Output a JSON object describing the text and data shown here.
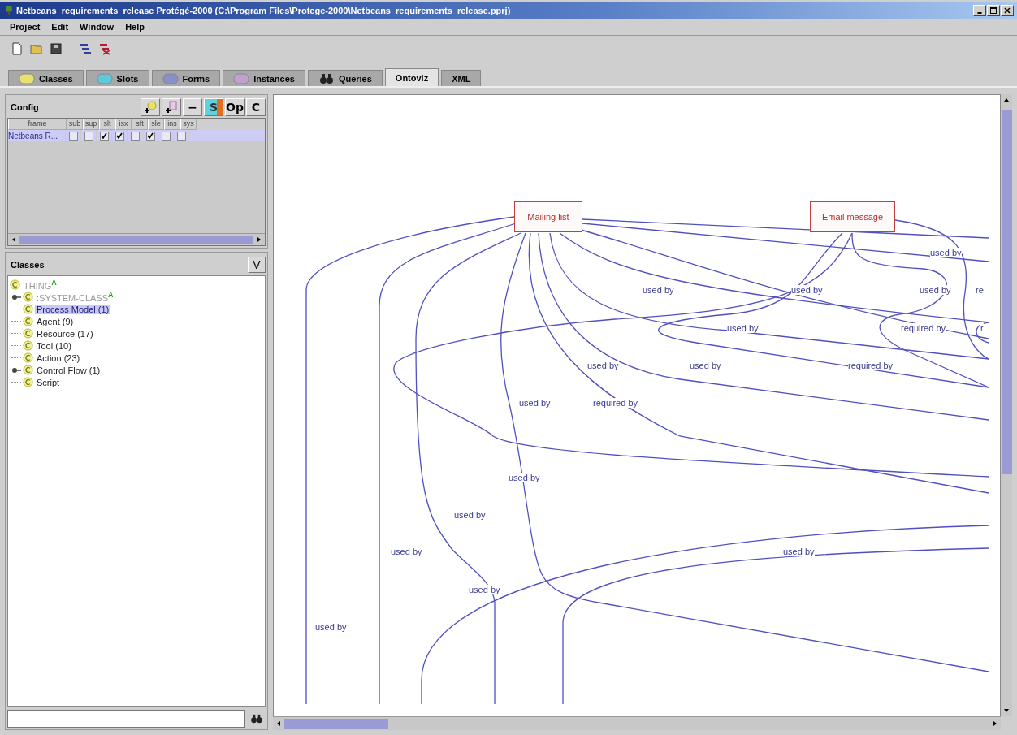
{
  "window": {
    "title": "Netbeans_requirements_release  Protégé-2000   (C:\\Program Files\\Protege-2000\\Netbeans_requirements_release.pprj)"
  },
  "menu": [
    "Project",
    "Edit",
    "Window",
    "Help"
  ],
  "tabs": [
    {
      "label": "Classes",
      "kind": "classes",
      "selected": false
    },
    {
      "label": "Slots",
      "kind": "slots",
      "selected": false
    },
    {
      "label": "Forms",
      "kind": "forms",
      "selected": false
    },
    {
      "label": "Instances",
      "kind": "instances",
      "selected": false
    },
    {
      "label": "Queries",
      "kind": "queries",
      "selected": false
    },
    {
      "label": "Ontoviz",
      "kind": "plain",
      "selected": true
    },
    {
      "label": "XML",
      "kind": "plain",
      "selected": false
    }
  ],
  "config": {
    "title": "Config",
    "buttons": [
      {
        "kind": "add-class"
      },
      {
        "kind": "add-instance"
      },
      {
        "kind": "text",
        "label": "−"
      },
      {
        "kind": "slot",
        "label": "S"
      },
      {
        "kind": "text",
        "label": "Op"
      },
      {
        "kind": "text",
        "label": "C"
      }
    ],
    "columns": [
      "frame",
      "sub",
      "sup",
      "slt",
      "isx",
      "sft",
      "sle",
      "ins",
      "sys"
    ],
    "rows": [
      {
        "frame": "Netbeans R...",
        "selected": true,
        "checks": [
          false,
          false,
          true,
          true,
          false,
          true,
          false,
          false
        ]
      }
    ]
  },
  "classes": {
    "title": "Classes",
    "button": "V",
    "tree": [
      {
        "label": "THING",
        "badge": "A",
        "system": true,
        "selected": false,
        "children": [
          {
            "label": ":SYSTEM-CLASS",
            "badge": "A",
            "system": true,
            "selected": false,
            "expanded": false
          },
          {
            "label": "Process Model  (1)",
            "system": false,
            "selected": true
          },
          {
            "label": "Agent  (9)",
            "system": false,
            "selected": false
          },
          {
            "label": "Resource  (17)",
            "system": false,
            "selected": false
          },
          {
            "label": "Tool  (10)",
            "system": false,
            "selected": false
          },
          {
            "label": "Action  (23)",
            "system": false,
            "selected": false
          },
          {
            "label": "Control Flow  (1)",
            "system": false,
            "selected": false,
            "expanded": false
          },
          {
            "label": "Script",
            "system": false,
            "selected": false
          }
        ]
      }
    ]
  },
  "graph": {
    "nodes": [
      {
        "label": "Mailing list"
      },
      {
        "label": "Email message"
      }
    ],
    "edge_labels": [
      "used by",
      "used by",
      "used by",
      "used by",
      "re",
      "used by",
      "required by",
      "r",
      "used by",
      "used by",
      "required by",
      "used by",
      "required by",
      "used by",
      "used by",
      "used by",
      "used by",
      "used by",
      "used by"
    ]
  }
}
